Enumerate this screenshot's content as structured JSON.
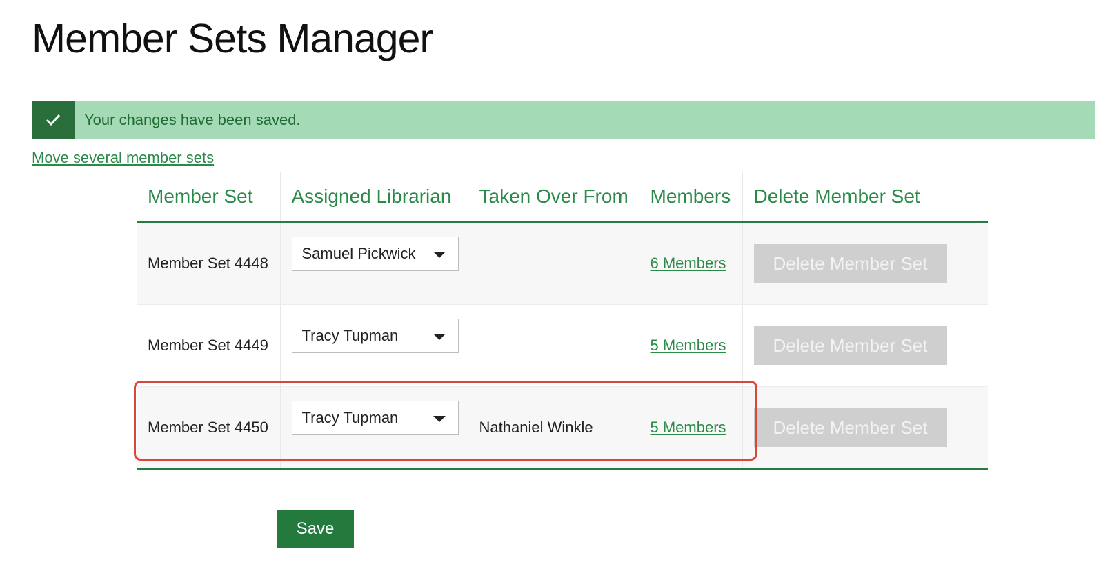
{
  "page": {
    "title": "Member Sets Manager"
  },
  "alert": {
    "message": "Your changes have been saved.",
    "icon": "check-icon"
  },
  "links": {
    "move_several": "Move several member sets"
  },
  "table": {
    "headers": [
      "Member Set",
      "Assigned Librarian",
      "Taken Over From",
      "Members",
      "Delete Member Set"
    ],
    "rows": [
      {
        "member_set": "Member Set 4448",
        "librarian": "Samuel Pickwick",
        "taken_over_from": "",
        "members": "6 Members",
        "delete_label": "Delete Member Set"
      },
      {
        "member_set": "Member Set 4449",
        "librarian": "Tracy Tupman",
        "taken_over_from": "",
        "members": "5 Members",
        "delete_label": "Delete Member Set"
      },
      {
        "member_set": "Member Set 4450",
        "librarian": "Tracy Tupman",
        "taken_over_from": "Nathaniel Winkle",
        "members": "5 Members",
        "delete_label": "Delete Member Set"
      }
    ]
  },
  "actions": {
    "save_label": "Save"
  },
  "colors": {
    "brand_green": "#237a3c",
    "link_green": "#2b8a4a",
    "alert_bg": "#a5dab7",
    "highlight_red": "#d9473a",
    "disabled_button": "#cfcfcf"
  }
}
